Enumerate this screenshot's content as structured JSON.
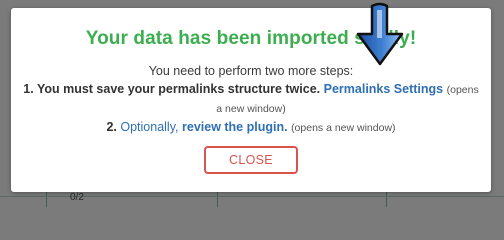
{
  "background": {
    "partial_text": "0/2"
  },
  "modal": {
    "title": "Your data has been imported s   fully!",
    "intro": "You need to perform two more steps:",
    "step1": {
      "prefix": "1. You must save your permalinks structure twice.",
      "link": "Permalinks Settings",
      "note": "(opens a new window)"
    },
    "step2": {
      "prefix": "2.",
      "link_optional": "Optionally,",
      "link_review": "review the plugin.",
      "note": "(opens a new window)"
    },
    "close_label": "CLOSE"
  },
  "colors": {
    "title_green": "#3cae4f",
    "link_blue": "#2f6fb4",
    "close_red": "#d9534f",
    "overlay": "#7b7b7b"
  },
  "icons": {
    "cursor": "arrow-down-cursor-icon"
  }
}
